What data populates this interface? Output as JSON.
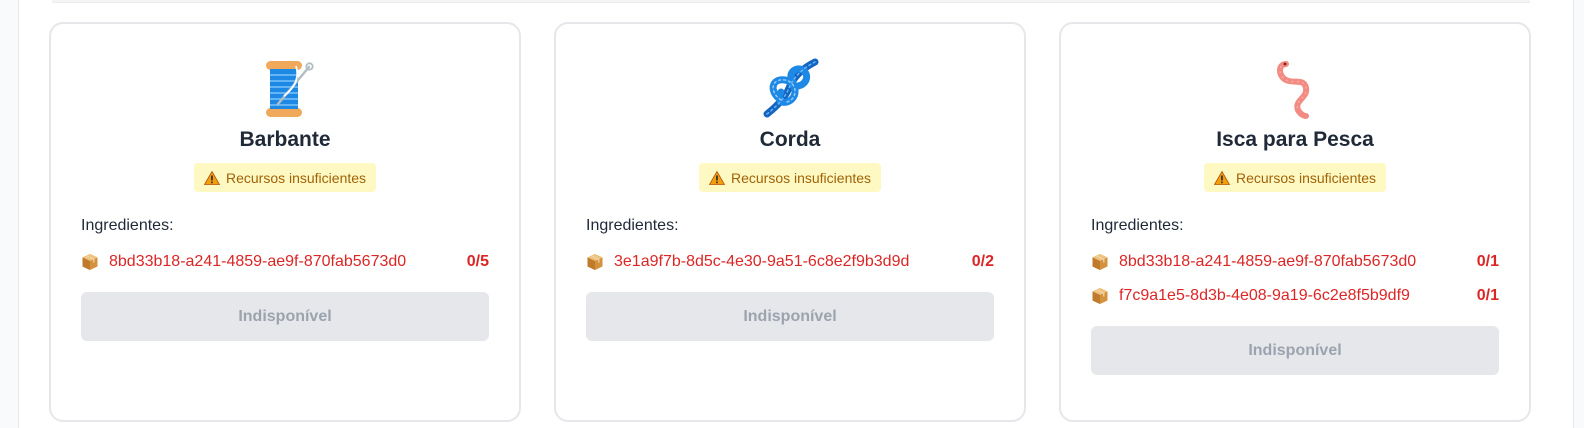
{
  "cards": [
    {
      "title": "Barbante",
      "icon": "thread-spool-icon",
      "status": "Recursos insuficientes",
      "ingredients_label": "Ingredientes:",
      "ingredients": [
        {
          "id": "8bd33b18-a241-4859-ae9f-870fab5673d0",
          "count": "0/5"
        }
      ],
      "button_label": "Indisponível"
    },
    {
      "title": "Corda",
      "icon": "knot-icon",
      "status": "Recursos insuficientes",
      "ingredients_label": "Ingredientes:",
      "ingredients": [
        {
          "id": "3e1a9f7b-8d5c-4e30-9a51-6c8e2f9b3d9d",
          "count": "0/2"
        }
      ],
      "button_label": "Indisponível"
    },
    {
      "title": "Isca para Pesca",
      "icon": "worm-icon",
      "status": "Recursos insuficientes",
      "ingredients_label": "Ingredientes:",
      "ingredients": [
        {
          "id": "8bd33b18-a241-4859-ae9f-870fab5673d0",
          "count": "0/1"
        },
        {
          "id": "f7c9a1e5-8d3b-4e08-9a19-6c2e8f5b9df9",
          "count": "0/1"
        }
      ],
      "button_label": "Indisponível"
    }
  ],
  "colors": {
    "missing": "#dc2626",
    "warning_bg": "#fef9c3",
    "warning_text": "#a16207",
    "disabled_bg": "#e5e7eb",
    "disabled_text": "#9ca3af"
  }
}
